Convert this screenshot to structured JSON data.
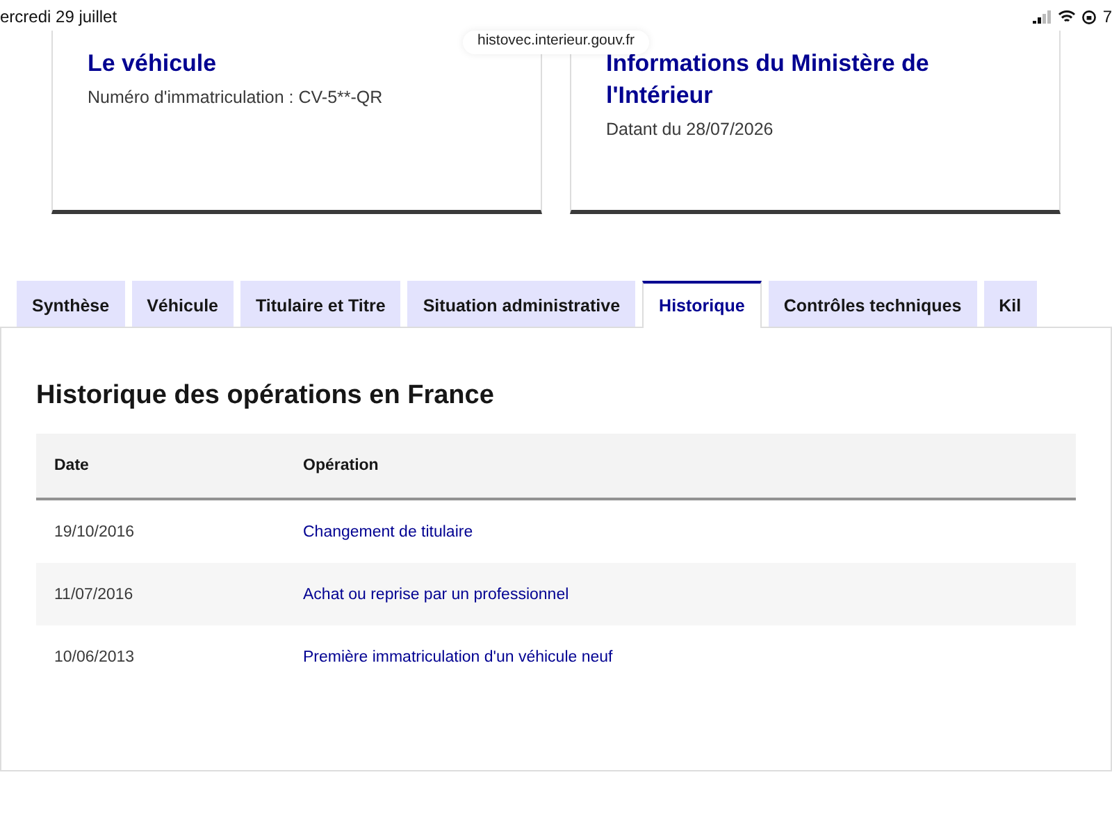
{
  "status_bar": {
    "date": "ercredi 29 juillet",
    "battery": "7"
  },
  "url_bar": {
    "url": "histovec.interieur.gouv.fr"
  },
  "cards": [
    {
      "title": "Le véhicule",
      "text": "Numéro d'immatriculation : CV-5**-QR"
    },
    {
      "title": "Informations du Ministère de l'Intérieur",
      "text": "Datant du 28/07/2026"
    }
  ],
  "tabs": [
    {
      "label": "Synthèse",
      "selected": false
    },
    {
      "label": "Véhicule",
      "selected": false
    },
    {
      "label": "Titulaire et Titre",
      "selected": false
    },
    {
      "label": "Situation administrative",
      "selected": false
    },
    {
      "label": "Historique",
      "selected": true
    },
    {
      "label": "Contrôles techniques",
      "selected": false
    },
    {
      "label": "Kil",
      "selected": false
    }
  ],
  "panel": {
    "heading": "Historique des opérations en France",
    "table": {
      "columns": [
        "Date",
        "Opération"
      ],
      "rows": [
        [
          "19/10/2016",
          "Changement de titulaire"
        ],
        [
          "11/07/2016",
          "Achat ou reprise par un professionnel"
        ],
        [
          "10/06/2013",
          "Première immatriculation d'un véhicule neuf"
        ]
      ]
    }
  }
}
